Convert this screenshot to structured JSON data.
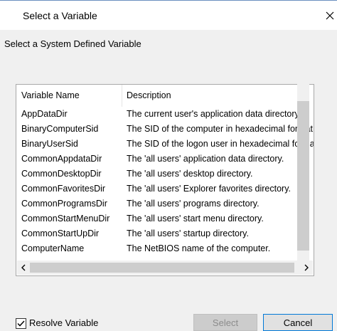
{
  "dialog": {
    "title": "Select a Variable",
    "subtitle": "Select a System Defined Variable"
  },
  "list": {
    "columns": [
      "Variable Name",
      "Description"
    ],
    "rows": [
      {
        "name": "AppDataDir",
        "desc": "The current user's application data directory"
      },
      {
        "name": "BinaryComputerSid",
        "desc": "The SID of the computer in hexadecimal format"
      },
      {
        "name": "BinaryUserSid",
        "desc": "The SID of the logon user in hexadecimal format"
      },
      {
        "name": "CommonAppdataDir",
        "desc": "The 'all users' application data directory."
      },
      {
        "name": "CommonDesktopDir",
        "desc": "The 'all users' desktop directory."
      },
      {
        "name": "CommonFavoritesDir",
        "desc": "The 'all users' Explorer favorites directory."
      },
      {
        "name": "CommonProgramsDir",
        "desc": "The 'all users' programs directory."
      },
      {
        "name": "CommonStartMenuDir",
        "desc": "The 'all users' start menu directory."
      },
      {
        "name": "CommonStartUpDir",
        "desc": "The 'all users' startup directory."
      },
      {
        "name": "ComputerName",
        "desc": "The NetBIOS name of the computer."
      }
    ]
  },
  "footer": {
    "resolve_label": "Resolve Variable",
    "resolve_checked": true,
    "select_label": "Select",
    "cancel_label": "Cancel"
  },
  "icons": {
    "close": "close-icon",
    "scroll_left": "chevron-left-icon",
    "scroll_right": "chevron-right-icon",
    "check": "checkmark-icon"
  },
  "colors": {
    "focus_border": "#0078d7",
    "disabled_text": "#8c8c8c"
  }
}
